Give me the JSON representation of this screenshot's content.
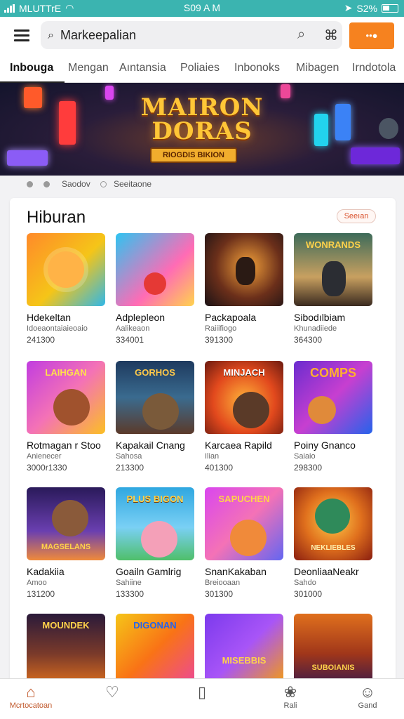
{
  "status_bar": {
    "carrier": "MLUTTrE",
    "time": "S09 A M",
    "battery": "S2%"
  },
  "header": {
    "search_value": "Markeepalian",
    "cta_label": "••●"
  },
  "tabs": [
    {
      "label": "Inbouga"
    },
    {
      "label": "Mengan"
    },
    {
      "label": "Aıntansia"
    },
    {
      "label": "Poliaies"
    },
    {
      "label": "Inbonoks"
    },
    {
      "label": "Mibagen"
    },
    {
      "label": "Irndotola"
    }
  ],
  "banner": {
    "title_line1": "MAIRON",
    "title_line2": "DORAS",
    "ribbon": "RIOGDIS BIKION"
  },
  "carousel": {
    "label1": "Saodov",
    "label2": "Seeitaone"
  },
  "section": {
    "title": "Hiburan",
    "more_label": "Seeıan"
  },
  "games": [
    {
      "name": "Hdekeltan",
      "sub": "Idoeaontaiaieoaio",
      "count": "241300",
      "thumb_title": ""
    },
    {
      "name": "Adplepleon",
      "sub": "Aalikeaon",
      "count": "334001",
      "thumb_title": ""
    },
    {
      "name": "Packapoala",
      "sub": "Raiiifiogo",
      "count": "391300",
      "thumb_title": ""
    },
    {
      "name": "Sibodılbiam",
      "sub": "Khunadiiede",
      "count": "364300",
      "thumb_title": "WONRANDS"
    },
    {
      "name": "Rotmagan r Stoo",
      "sub": "Anienecer",
      "count": "3000r1330",
      "thumb_title": "LAIHGAN"
    },
    {
      "name": "Kapakail Cnang",
      "sub": "Sahosa",
      "count": "213300",
      "thumb_title": "GORHOS"
    },
    {
      "name": "Karcaea Rapild",
      "sub": "Ilian",
      "count": "401300",
      "thumb_title": "MINJACH"
    },
    {
      "name": "Poiny Gnanco",
      "sub": "Saiaio",
      "count": "298300",
      "thumb_title": "COMPS"
    },
    {
      "name": "Kadakiia",
      "sub": "Amoo",
      "count": "131200",
      "thumb_title": "MAGSELANS"
    },
    {
      "name": "Goailn Gamlrig",
      "sub": "Sahiine",
      "count": "133300",
      "thumb_title": "PLUS BIGON"
    },
    {
      "name": "SnanKakaban",
      "sub": "Breiooaan",
      "count": "301300",
      "thumb_title": "SAPUCHEN"
    },
    {
      "name": "DeonliaaNeakr",
      "sub": "Sahdo",
      "count": "301000",
      "thumb_title": "NEKLIEBLES"
    },
    {
      "name": "",
      "sub": "",
      "count": "",
      "thumb_title": "MOUNDEK"
    },
    {
      "name": "",
      "sub": "",
      "count": "",
      "thumb_title": "DIGONAN"
    },
    {
      "name": "",
      "sub": "",
      "count": "",
      "thumb_title": "MISEBBIS"
    },
    {
      "name": "",
      "sub": "",
      "count": "",
      "thumb_title": "SUBOIANIS"
    }
  ],
  "bottom_nav": [
    {
      "label": "Mcrtocatoan",
      "icon": "home-icon"
    },
    {
      "label": "",
      "icon": "location-icon"
    },
    {
      "label": "",
      "icon": "card-icon"
    },
    {
      "label": "Rali",
      "icon": "gift-icon"
    },
    {
      "label": "Gand",
      "icon": "profile-icon"
    }
  ],
  "colors": {
    "accent": "#f6821f",
    "status_bar": "#3bb4b0",
    "active_nav": "#c0572a"
  }
}
